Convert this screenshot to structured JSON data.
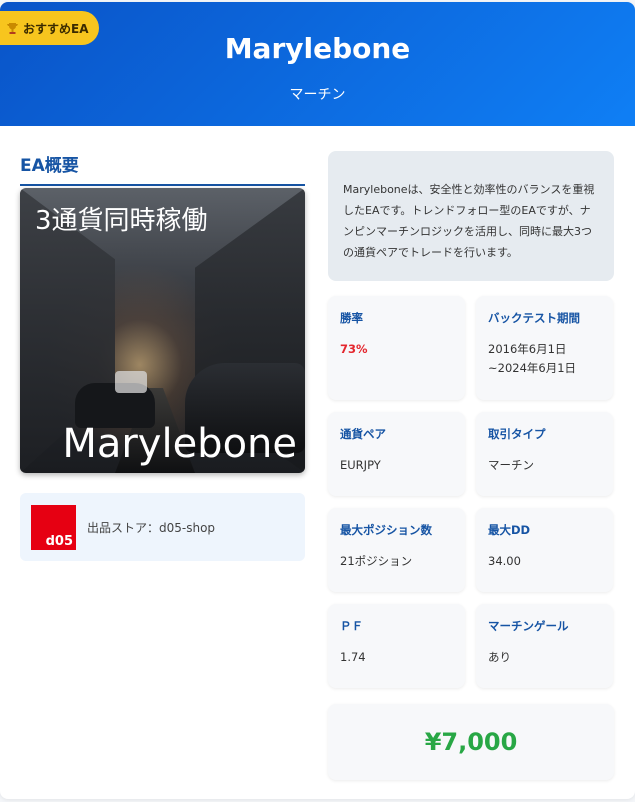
{
  "header": {
    "badge_label": "おすすめEA",
    "badge_icon": "trophy-icon",
    "title": "Marylebone",
    "subtitle": "マーチン",
    "gradient_colors": [
      "#0a54c8",
      "#0f7ff5"
    ]
  },
  "overview": {
    "section_title": "EA概要",
    "image_caption_top": "3通貨同時稼働",
    "image_caption_bottom": "Marylebone"
  },
  "store": {
    "logo_text": "d05",
    "label": "出品ストア：d05-shop"
  },
  "description": "Maryleboneは、安全性と効率性のバランスを重視したEAです。トレンドフォロー型のEAですが、ナンピンマーチンロジックを活用し、同時に最大3つの通貨ペアでトレードを行います。",
  "stats": [
    {
      "label": "勝率",
      "value": "73%"
    },
    {
      "label": "バックテスト期間",
      "value": "2016年6月1日~2024年6月1日"
    },
    {
      "label": "通貨ペア",
      "value": "EURJPY"
    },
    {
      "label": "取引タイプ",
      "value": "マーチン"
    },
    {
      "label": "最大ポジション数",
      "value": "21ポジション"
    },
    {
      "label": "最大DD",
      "value": "34.00"
    },
    {
      "label": "ＰＦ",
      "value": "1.74"
    },
    {
      "label": "マーチンゲール",
      "value": "あり"
    }
  ],
  "price": "¥7,000",
  "colors": {
    "accent": "#1654a4",
    "win_rate": "#e4262d",
    "price": "#28a745",
    "badge": "#f7c51e",
    "store_logo": "#e60012"
  }
}
